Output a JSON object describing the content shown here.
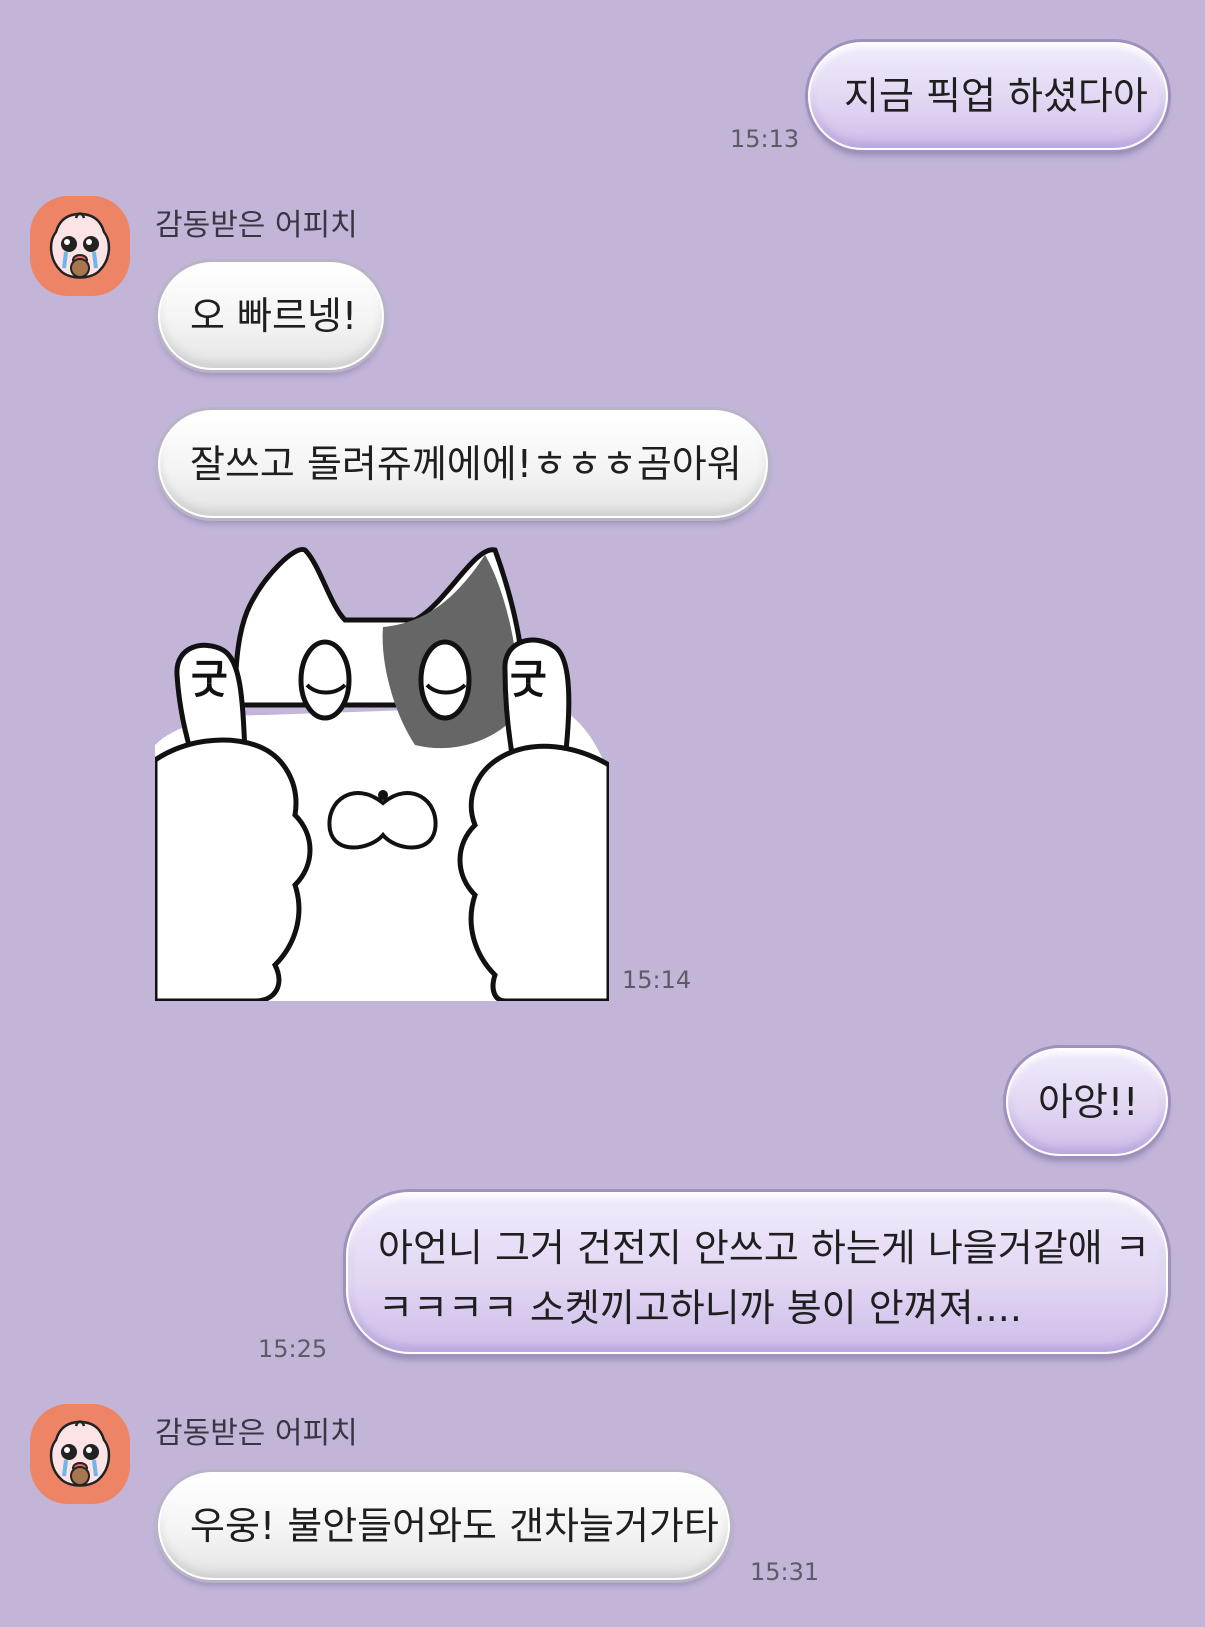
{
  "messages": [
    {
      "sender": "me",
      "text": "지금 픽업 하셨다아",
      "time": "15:13"
    },
    {
      "sender": "other",
      "sender_name": "감동받은 어피치",
      "text": "오 빠르넹!"
    },
    {
      "sender": "other",
      "text": "잘쓰고 돌려쥬께에에!ㅎㅎㅎ곰아워"
    },
    {
      "sender": "other",
      "type": "sticker",
      "sticker_words": [
        "굿",
        "굿"
      ],
      "time": "15:14"
    },
    {
      "sender": "me",
      "text": "아앙!!"
    },
    {
      "sender": "me",
      "line1": "아언니 그거 건전지 안쓰고 하는게 나을거같애 ㅋ",
      "line2": "ㅋㅋㅋㅋ 소켓끼고하니까 봉이 안껴져....",
      "time": "15:25"
    },
    {
      "sender": "other",
      "sender_name": "감동받은 어피치",
      "text": "우웅! 불안들어와도 갠차늘거가타",
      "time": "15:31"
    }
  ],
  "colors": {
    "background": "#c2b5d8",
    "avatar": "#ee8466"
  },
  "icons": {
    "avatar": "apeach-crying-icon"
  }
}
